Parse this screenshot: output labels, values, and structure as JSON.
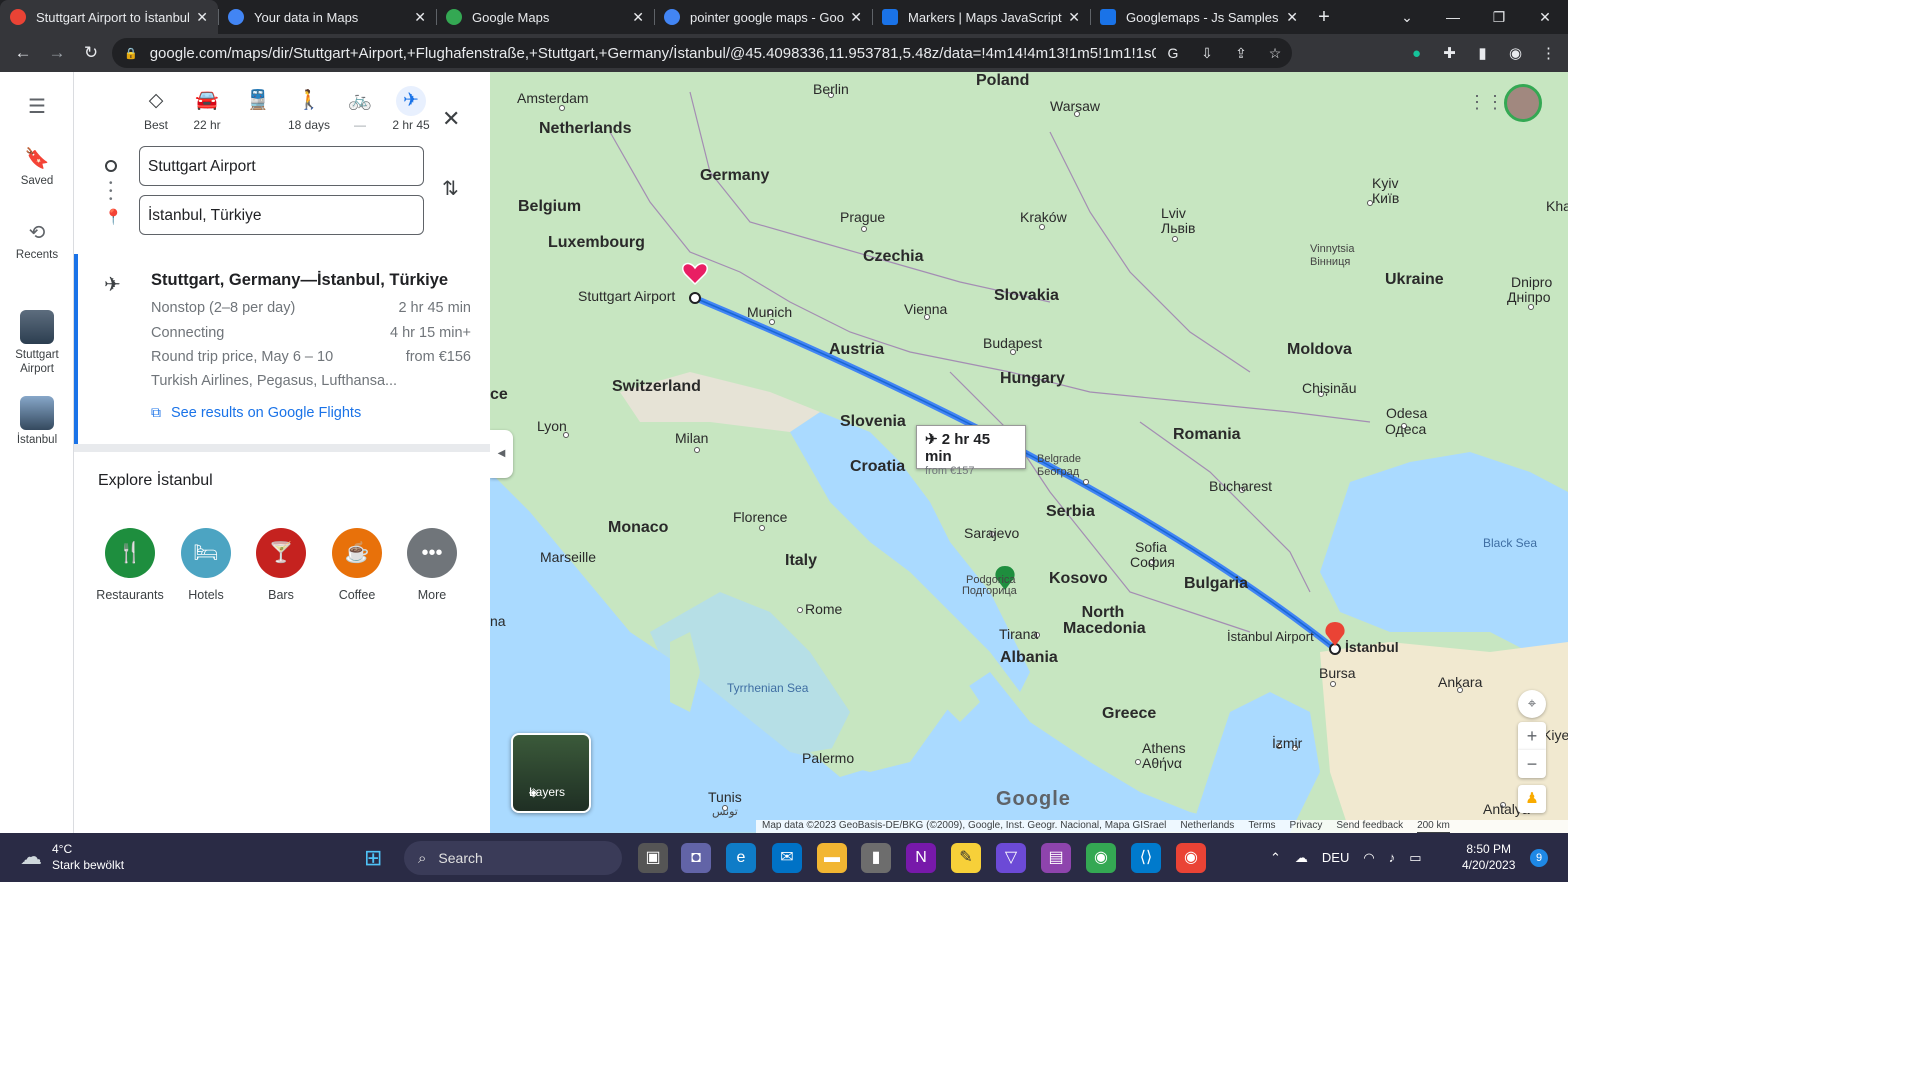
{
  "browser": {
    "tabs": [
      {
        "title": "Stuttgart Airport to İstanbul",
        "icon": "maps-pin-icon",
        "color": "#ea4335",
        "active": true
      },
      {
        "title": "Your data in Maps",
        "icon": "google-icon",
        "color": "#4285f4",
        "active": false
      },
      {
        "title": "Google Maps",
        "icon": "maps-pin-icon",
        "color": "#34a853",
        "active": false
      },
      {
        "title": "pointer google maps - Goo",
        "icon": "google-icon",
        "color": "#4285f4",
        "active": false
      },
      {
        "title": "Markers  |  Maps JavaScript",
        "icon": "dev-icon",
        "color": "#1a73e8",
        "active": false
      },
      {
        "title": "Googlemaps - Js Samples",
        "icon": "bolt-icon",
        "color": "#1a73e8",
        "active": false
      }
    ],
    "url": "google.com/maps/dir/Stuttgart+Airport,+Flughafenstraße,+Stuttgart,+Germany/İstanbul/@45.4098336,11.953781,5.48z/data=!4m14!4m13!1m5!1m1!1s0x4799c28ca5ce6fb5:0..."
  },
  "rail": {
    "saved": "Saved",
    "recents": "Recents",
    "stuttgart": "Stuttgart Airport",
    "istanbul": "İstanbul"
  },
  "modes": [
    {
      "label": "Best",
      "icon": "directions-icon"
    },
    {
      "label": "22 hr",
      "icon": "car-icon"
    },
    {
      "label": "",
      "icon": "transit-icon"
    },
    {
      "label": "18 days",
      "icon": "walk-icon"
    },
    {
      "label": "—",
      "icon": "bike-icon"
    },
    {
      "label": "2 hr 45",
      "icon": "plane-icon"
    }
  ],
  "route": {
    "origin": "Stuttgart Airport",
    "destination": "İstanbul, Türkiye",
    "title": "Stuttgart, Germany—İstanbul, Türkiye",
    "rows": [
      {
        "label": "Nonstop (2–8 per day)",
        "value": "2 hr 45 min"
      },
      {
        "label": "Connecting",
        "value": "4 hr 15 min+"
      },
      {
        "label": "Round trip price, May 6 – 10",
        "value": "from €156"
      },
      {
        "label": "Turkish Airlines, Pegasus, Lufthansa...",
        "value": ""
      }
    ],
    "link": "See results on Google Flights"
  },
  "explore": {
    "title": "Explore İstanbul",
    "items": [
      {
        "label": "Restaurants",
        "color": "#1e8e3e",
        "icon": "fork-knife-icon"
      },
      {
        "label": "Hotels",
        "color": "#4ca4c2",
        "icon": "bed-icon"
      },
      {
        "label": "Bars",
        "color": "#c5221f",
        "icon": "cocktail-icon"
      },
      {
        "label": "Coffee",
        "color": "#e8710a",
        "icon": "coffee-icon"
      },
      {
        "label": "More",
        "color": "#70757a",
        "icon": "more-icon"
      }
    ]
  },
  "map": {
    "countries": [
      "Poland",
      "Netherlands",
      "Germany",
      "Belgium",
      "Luxembourg",
      "Czechia",
      "Slovakia",
      "Ukraine",
      "Austria",
      "Hungary",
      "Moldova",
      "Switzerland",
      "Slovenia",
      "Romania",
      "Croatia",
      "Serbia",
      "Monaco",
      "Italy",
      "Kosovo",
      "Bulgaria",
      "North Macedonia",
      "Albania",
      "Greece"
    ],
    "cities": [
      "Berlin",
      "Amsterdam",
      "Warsaw",
      "Kyiv",
      "Київ",
      "Lviv",
      "Львів",
      "Prague",
      "Kraków",
      "Vinnytsia",
      "Вінниця",
      "Dnipro",
      "Дніпро",
      "Stuttgart Airport",
      "Munich",
      "Vienna",
      "Budapest",
      "Chișinău",
      "Odesa",
      "Одеса",
      "Lyon",
      "Milan",
      "Belgrade",
      "Београд",
      "Bucharest",
      "Florence",
      "Sarajevo",
      "Marseille",
      "Sofia",
      "София",
      "Podgorica",
      "Подгорица",
      "Rome",
      "Tirana",
      "İstanbul Airport",
      "İstanbul",
      "Bursa",
      "Ankara",
      "Palermo",
      "Athens",
      "Αθήνα",
      "İzmir",
      "Tunis",
      "تونس",
      "Antalya"
    ],
    "seas": [
      "Black Sea",
      "Tyrrhenian Sea"
    ],
    "edge_labels": [
      "Kha",
      "Kiye",
      "ce",
      "na"
    ],
    "flight_duration": "2 hr 45 min",
    "flight_price": "from €157",
    "layers": "Layers",
    "logo": "Google",
    "footer": [
      "Map data ©2023 GeoBasis-DE/BKG (©2009), Google, Inst. Geogr. Nacional, Mapa GISrael",
      "Netherlands",
      "Terms",
      "Privacy",
      "Send feedback",
      "200 km"
    ]
  },
  "taskbar": {
    "temp": "4°C",
    "weather": "Stark bewölkt",
    "search": "Search",
    "lang": "DEU",
    "time": "8:50 PM",
    "date": "4/20/2023",
    "notifications": "9"
  }
}
